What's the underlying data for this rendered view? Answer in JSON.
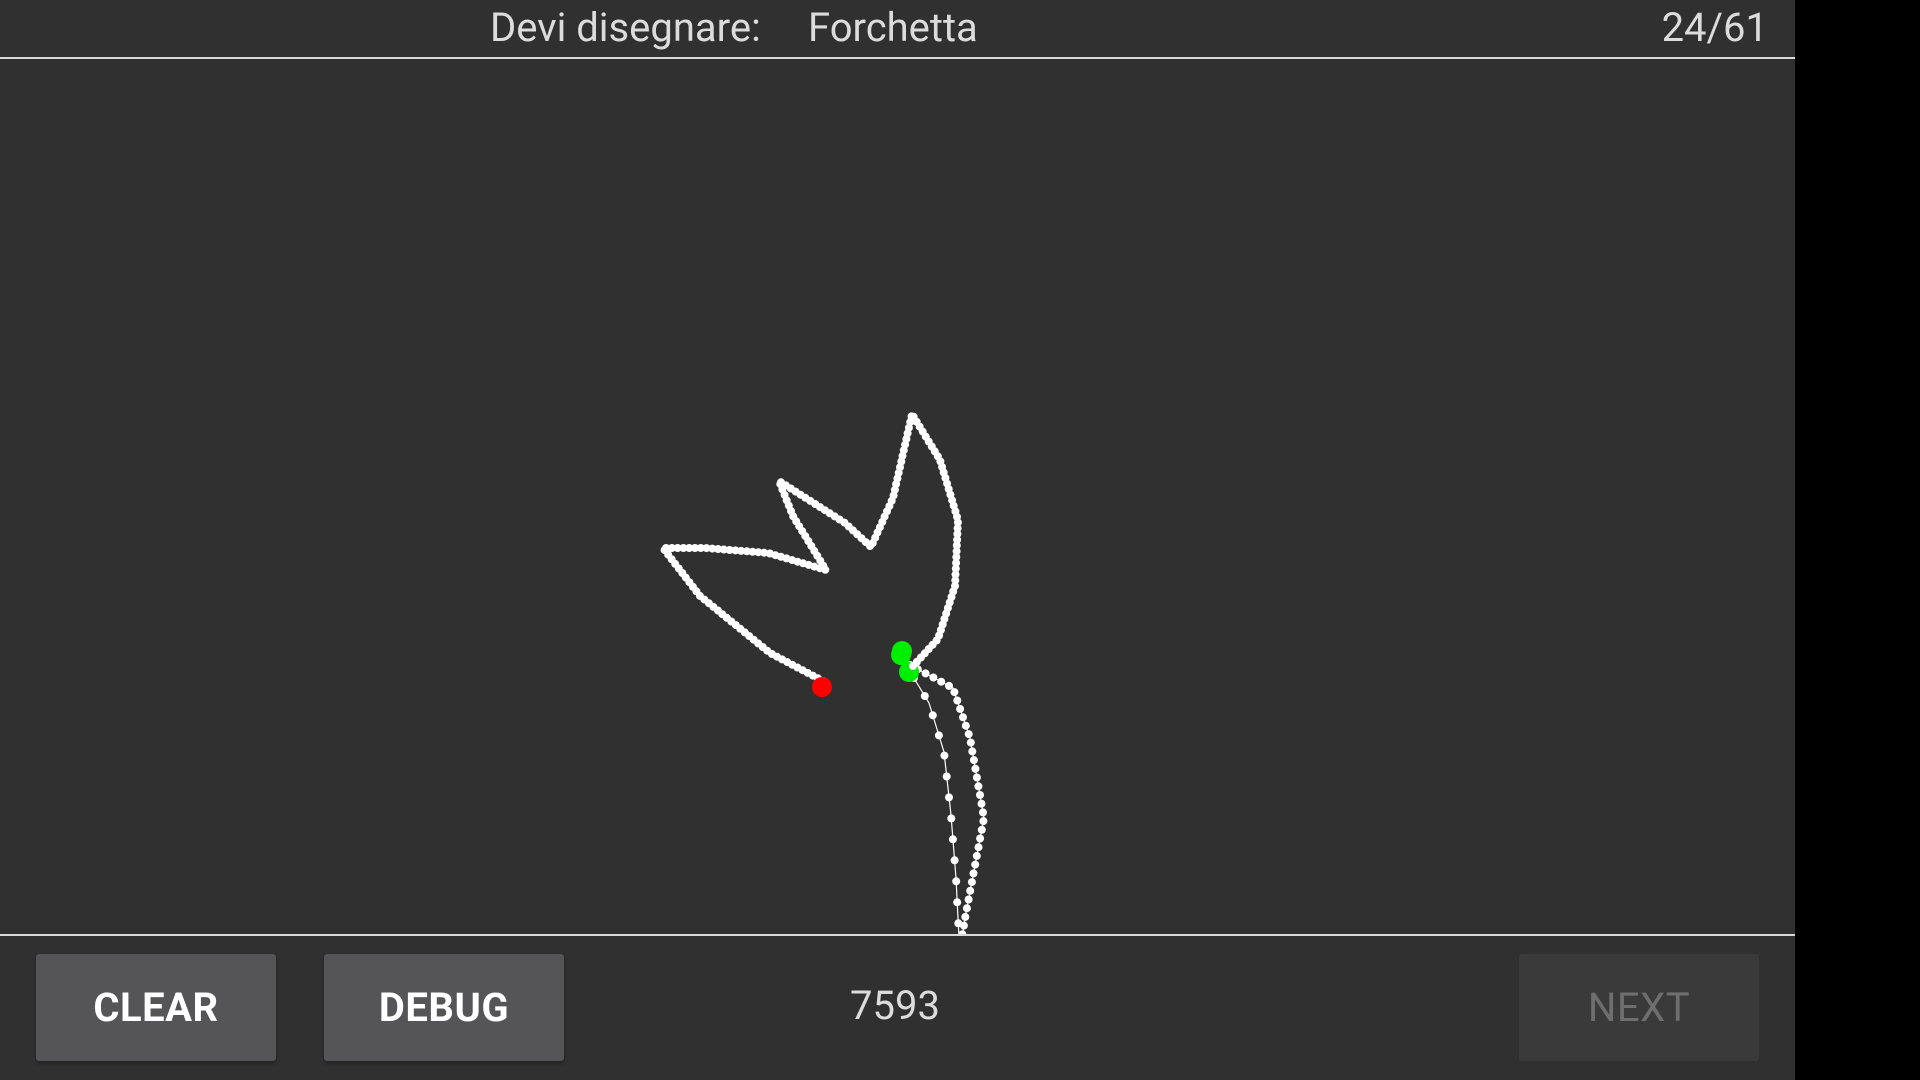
{
  "header": {
    "prompt_label": "Devi disegnare:",
    "prompt_word": "Forchetta",
    "progress": "24/61"
  },
  "footer": {
    "clear_label": "CLEAR",
    "debug_label": "DEBUG",
    "score": "7593",
    "next_label": "NEXT"
  },
  "colors": {
    "background": "#303030",
    "stroke": "#ffffff",
    "stroke_start": "#00ee00",
    "stroke_end": "#ff0000"
  }
}
